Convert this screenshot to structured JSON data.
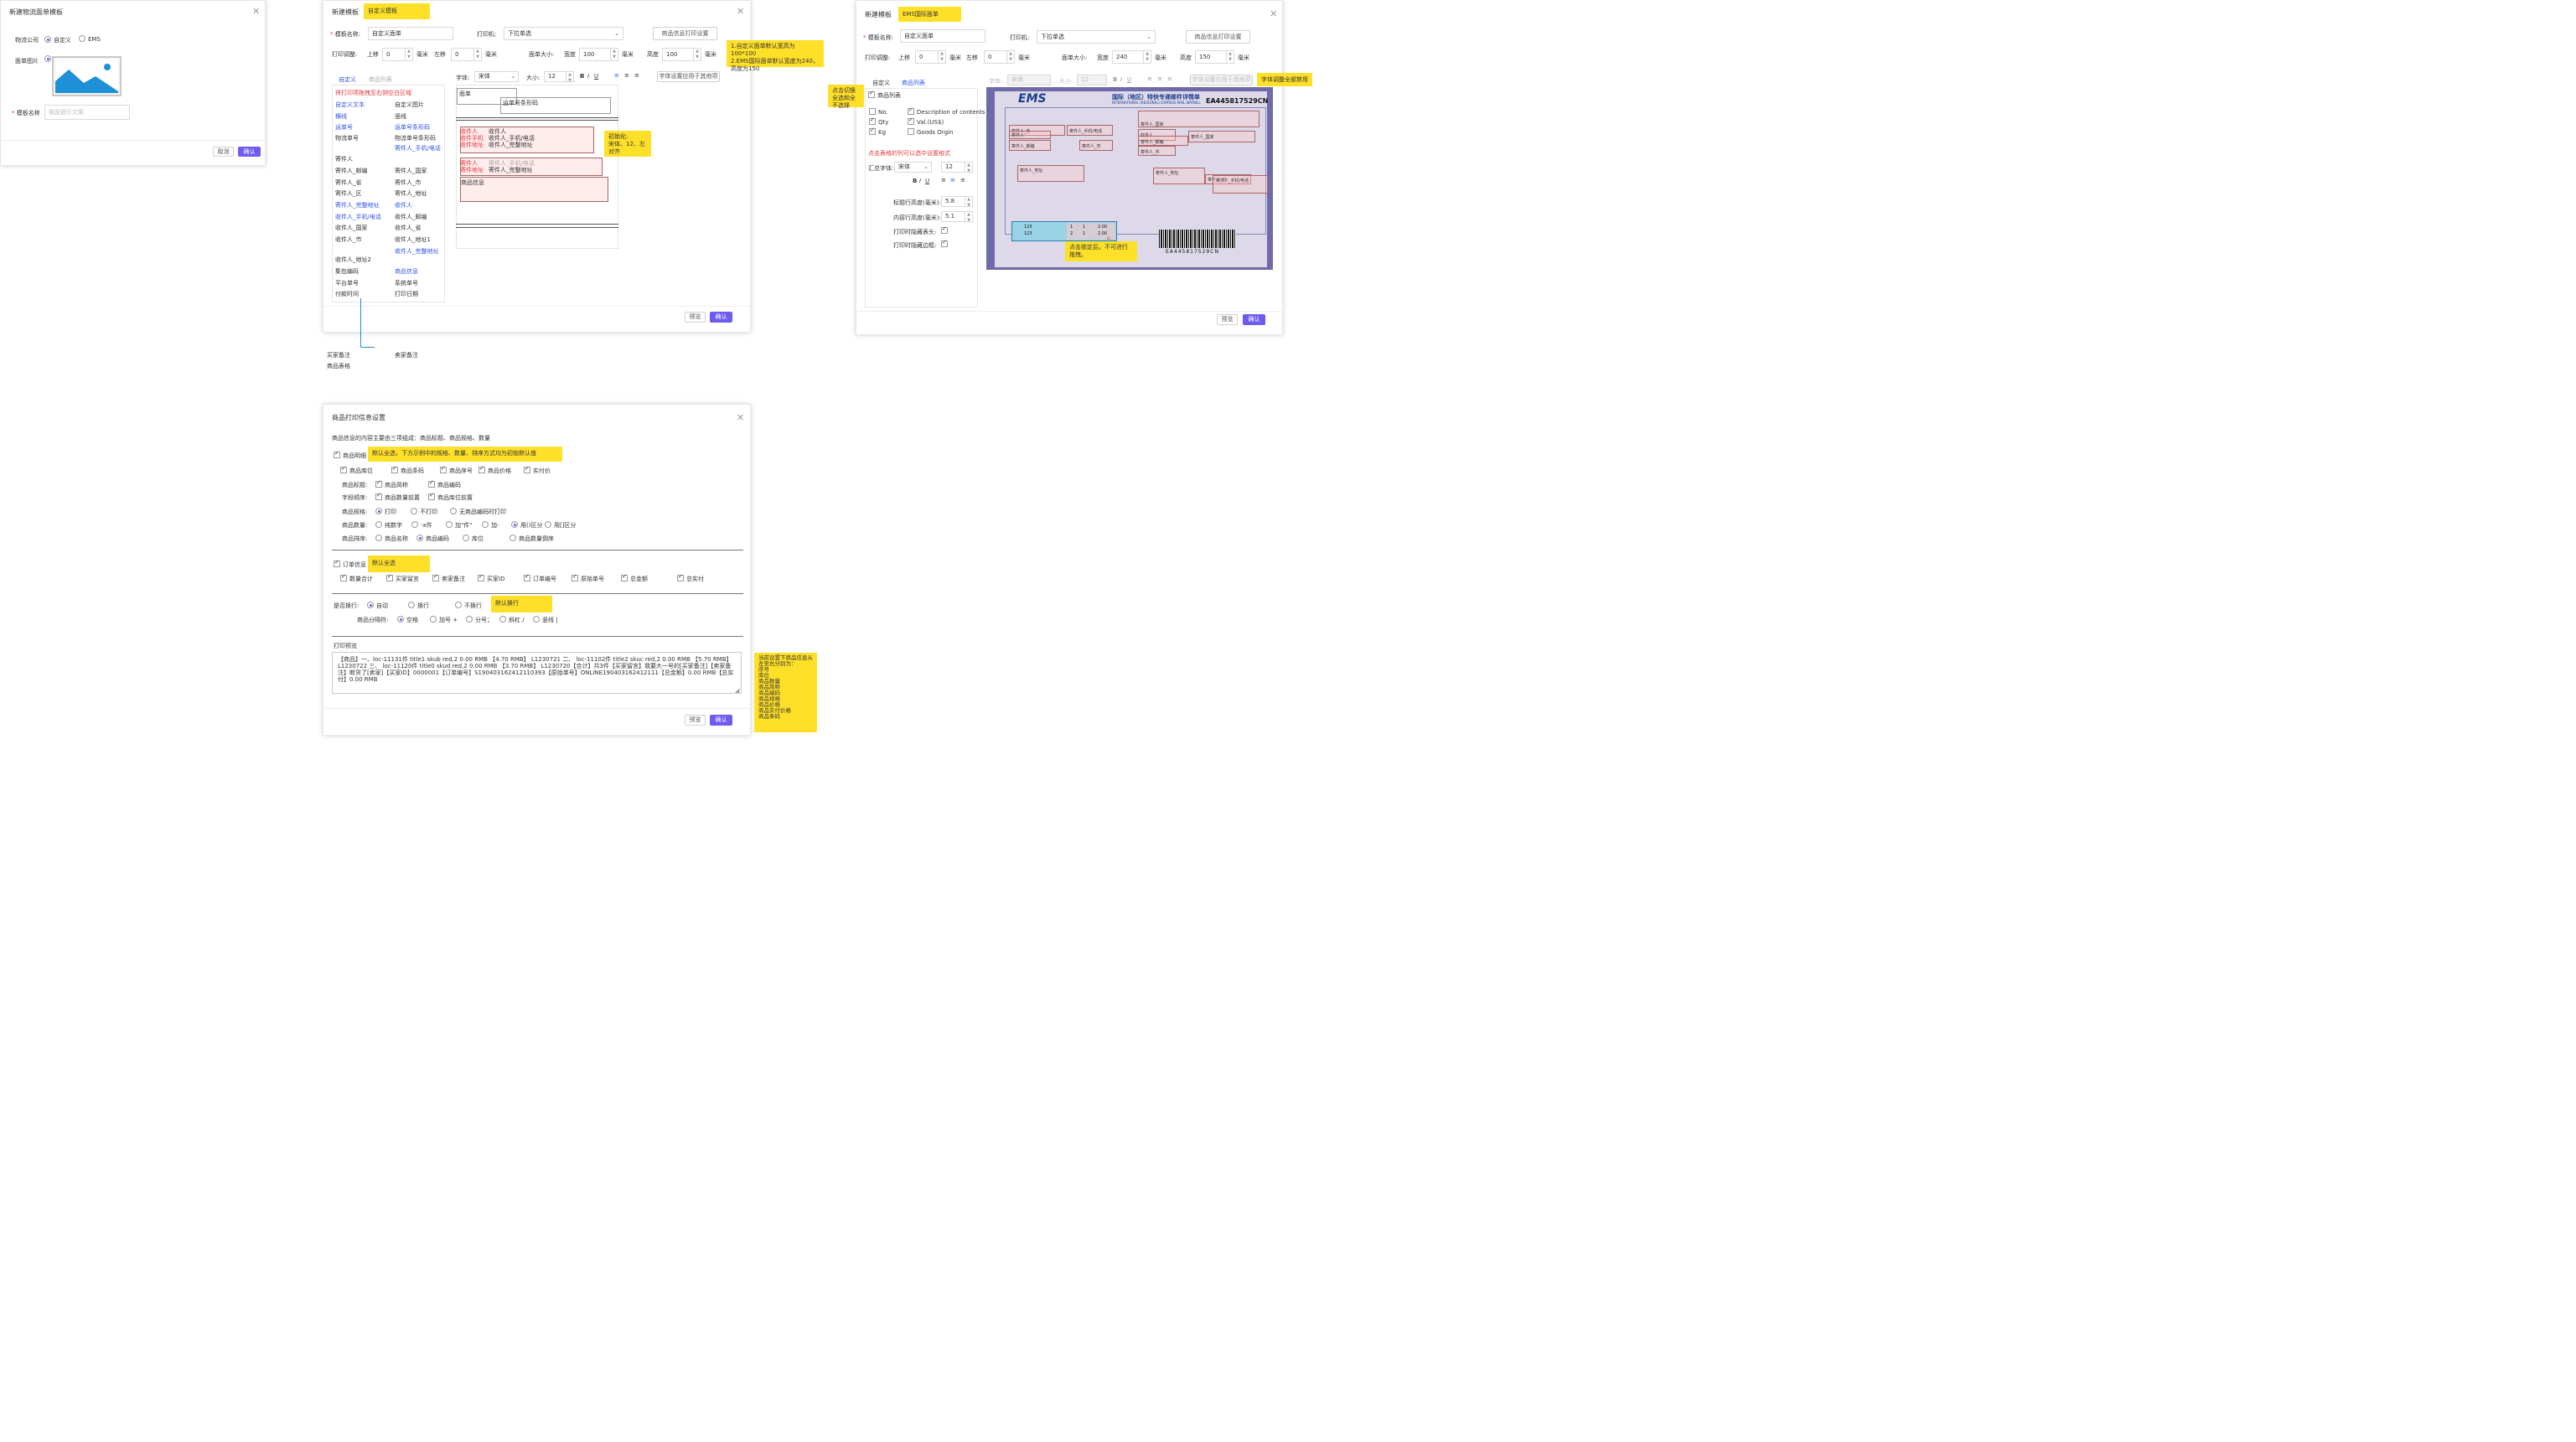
{
  "p1": {
    "title": "新建物流面单模板",
    "company_label": "物流公司",
    "opt_custom": "自定义",
    "opt_ems": "EMS",
    "image_label": "面单图片",
    "name_label": "模板名称",
    "name_placeholder": "我是提示文案",
    "cancel": "取消",
    "ok": "确认"
  },
  "p2": {
    "title": "新建模板",
    "tag": "自定义模板",
    "name_label": "模板名称:",
    "name_value": "自定义面单",
    "printer_label": "打印机:",
    "printer_value": "下拉单选",
    "goods_btn": "商品信息打印设置",
    "adjust_label": "打印调整:",
    "top_label": "上移",
    "top_value": "0",
    "unit": "毫米",
    "left_label": "左移",
    "left_value": "0",
    "size_label": "面单大小:",
    "width_label": "宽度",
    "width_value": "100",
    "height_label": "高度",
    "height_value": "100",
    "note_default": "1.自定义面单默认宽高为100*100\n2.EMS国际面单默认宽度为240，高度为150",
    "tab_custom": "自定义",
    "tab_goods": "商品列表",
    "font_label": "字体:",
    "font_value": "宋体",
    "size_label2": "大小:",
    "size_value": "12",
    "apply_btn": "字体设置应用于其他项",
    "drag_hint": "将打印项拖拽至右侧空白区域",
    "items_left": [
      {
        "t": "自定义文本",
        "c": "blue"
      },
      {
        "t": "横线",
        "c": "blue"
      },
      {
        "t": "运单号",
        "c": "blue"
      },
      {
        "t": "物流单号",
        "c": ""
      },
      {
        "t": "",
        "c": ""
      },
      {
        "t": "寄件人",
        "c": ""
      },
      {
        "t": "寄件人_邮编",
        "c": ""
      },
      {
        "t": "寄件人_省",
        "c": ""
      },
      {
        "t": "寄件人_区",
        "c": ""
      },
      {
        "t": "寄件人_完整地址",
        "c": "blue"
      },
      {
        "t": "收件人_手机/电话",
        "c": "blue"
      },
      {
        "t": "收件人_国家",
        "c": ""
      },
      {
        "t": "收件人_市",
        "c": ""
      },
      {
        "t": "",
        "c": ""
      },
      {
        "t": "收件人_地址2",
        "c": ""
      },
      {
        "t": "集包编码",
        "c": ""
      },
      {
        "t": "平台单号",
        "c": ""
      },
      {
        "t": "付款时间",
        "c": ""
      }
    ],
    "items_right": [
      {
        "t": "自定义图片",
        "c": ""
      },
      {
        "t": "竖线",
        "c": ""
      },
      {
        "t": "运单号条形码",
        "c": "blue"
      },
      {
        "t": "物流单号条形码",
        "c": ""
      },
      {
        "t": "寄件人_手机/电话",
        "c": "blue"
      },
      {
        "t": "",
        "c": ""
      },
      {
        "t": "寄件人_国家",
        "c": ""
      },
      {
        "t": "寄件人_市",
        "c": ""
      },
      {
        "t": "寄件人_地址",
        "c": ""
      },
      {
        "t": "收件人",
        "c": "blue"
      },
      {
        "t": "收件人_邮编",
        "c": ""
      },
      {
        "t": "收件人_省",
        "c": ""
      },
      {
        "t": "收件人_地址1",
        "c": ""
      },
      {
        "t": "收件人_完整地址",
        "c": "blue"
      },
      {
        "t": "",
        "c": ""
      },
      {
        "t": "商品信息",
        "c": "blue"
      },
      {
        "t": "系统单号",
        "c": ""
      },
      {
        "t": "打印日期",
        "c": ""
      }
    ],
    "canvas": {
      "miandan": "面单",
      "waybill_barcode": "运单号条形码",
      "recv_label": "收件人",
      "recv_val": "收件人",
      "recv_phone_label": "收件手机",
      "recv_phone_val": "收件人_手机/电话",
      "recv_addr_label": "收件地址",
      "recv_addr_val": "收件人_完整地址",
      "send_label": "寄件人",
      "send_val": "寄件人_手机/电话",
      "send_addr_label": "寄件地址",
      "send_addr_val": "寄件人_完整地址",
      "goods": "商品信息"
    },
    "note_init": "初始化:\n宋体、12、左对齐",
    "preview": "预览",
    "ok": "确认",
    "overflow_left1": "买家备注",
    "overflow_left2": "商品表格",
    "overflow_right1": "卖家备注"
  },
  "p3": {
    "title": "新建模板",
    "tag": "EMS国际面单",
    "name_label": "模板名称:",
    "name_value": "自定义面单",
    "printer_label": "打印机:",
    "printer_value": "下拉单选",
    "goods_btn": "商品信息打印设置",
    "adjust_label": "打印调整:",
    "top_label": "上移",
    "top_value": "0",
    "unit": "毫米",
    "left_label": "左移",
    "left_value": "0",
    "size_label": "面单大小:",
    "width_label": "宽度",
    "width_value": "240",
    "height_label": "高度",
    "height_value": "150",
    "tab_custom": "自定义",
    "tab_goods": "商品列表",
    "goods_list_label": "商品列表",
    "cols": [
      {
        "t": "No.",
        "on": false
      },
      {
        "t": "Description of contents",
        "on": true
      },
      {
        "t": "Qty",
        "on": true
      },
      {
        "t": "Val.(US$)",
        "on": true
      },
      {
        "t": "Kg",
        "on": true
      },
      {
        "t": "Goods Orgin",
        "on": false
      }
    ],
    "hint_red": "点击表格的列可以选中设置格式",
    "sum_font_label": "汇总字体:",
    "sum_font_value": "宋体",
    "sum_size_value": "12",
    "title_h_label": "标题行高度(毫米):",
    "title_h_value": "5.8",
    "content_h_label": "内容行高度(毫米):",
    "content_h_value": "5.1",
    "hide_header_label": "打印时隐藏表头:",
    "hide_border_label": "打印时隐藏边框:",
    "note_toggle": "点击切换全选和全不选择",
    "font_label": "字体:",
    "font_value": "宋体",
    "size_label2": "大小:",
    "size_value": "12",
    "apply_btn": "字体设置应用于其他项",
    "note_disabled": "字体调整全部禁用",
    "note_lock": "点击锁定后，不可进行拖拽。",
    "ems_logo": "EMS",
    "ems_title": "国际（地区）特快专递邮件详情单",
    "ems_sub": "INTERNATIONAL (REGIONAL) EXPRESS MAIL WAYBILL",
    "ems_no": "EA445817529CN",
    "barcode_no": "EA445817529CN",
    "f_sender": "寄件人_省",
    "f_sender2": "寄件人",
    "f_phone": "寄件人_手机/电话",
    "f_zip": "寄件人_邮编",
    "f_city": "寄件人_市",
    "f_addr": "寄件人_地址",
    "f_country": "寄件人_国家",
    "r_name": "收件人",
    "r_zip": "寄件人_邮编",
    "r_addr": "寄件人_地址",
    "r_country": "寄件人_国家",
    "r_city": "寄件人_市",
    "r_prov": "寄件人_省",
    "r_phone": "寄件人_手机/电话",
    "rows": [
      [
        "123",
        "1",
        "1",
        "2.00"
      ],
      [
        "123",
        "2",
        "1",
        "2.00"
      ]
    ],
    "preview": "预览",
    "ok": "确认"
  },
  "p4": {
    "title": "商品打印信息设置",
    "intro": "商品信息的内容主要由三项组成：商品标题、商品规格、数量",
    "goods_detail": "商品明细",
    "note_default_all": "默认全选，下方示例中的规格、数量、排序方式均为初始默认值",
    "row1": [
      "商品库位",
      "商品条码",
      "商品序号",
      "商品价格",
      "实付价"
    ],
    "title_label": "商品标题:",
    "title_opts": [
      "商品简称",
      "商品编码"
    ],
    "order_label": "字段顺序:",
    "order_opts": [
      "商品数量前置",
      "商品库位前置"
    ],
    "spec_label": "商品规格:",
    "spec_opts": [
      "打印",
      "不打印",
      "无商品编码时打印"
    ],
    "qty_label": "商品数量:",
    "qty_opts": [
      "纯数字",
      "-x件",
      "加\"件\"",
      "加-",
      "用()区分",
      "用[]区分"
    ],
    "sort_label": "商品排序:",
    "sort_opts": [
      "商品名称",
      "商品编码",
      "库位",
      "商品数量倒序"
    ],
    "order_info": "订单信息",
    "note_all": "默认全选",
    "order_fields": [
      "数量合计",
      "买家留言",
      "卖家备注",
      "买家ID",
      "订单编号",
      "原始单号",
      "总金额",
      "总实付"
    ],
    "wrap_label": "是否换行:",
    "wrap_opts": [
      "自动",
      "换行",
      "不换行"
    ],
    "note_wrap": "默认换行",
    "sep_label": "商品分隔符:",
    "sep_opts": [
      "空格",
      "加号 +",
      "分号；",
      "斜杠 /",
      "竖线 |"
    ],
    "preview_label": "打印预览",
    "preview_text": "【商品】一、loc-11131件 title1 skub red,2 0.00 RMB 【4.70 RMB】 L1230721 二、 loc-11102件 title2 skuc red,2 0.00 RMB 【5.70 RMB】 L1230722 三、 loc-11120件 title0 skud red,2 0.00 RMB 【3.70 RMB】 L1230720【合计】共3件【买家留言】我要大一号的[买家备注]【卖家备注】断货了[卖家]【买家ID】0000001【订单编号】S190403162412110393【原始单号】ONLINE190403162412111【总金额】0.00 RMB【总实付】0.00 RMB",
    "note_order": "当前设置下商品信息从左至右分别为：\n序号\n库位\n商品数量\n商品简称\n商品编码\n商品规格\n商品价格\n商品实付价格\n商品条码",
    "preview": "预览",
    "ok": "确认"
  }
}
